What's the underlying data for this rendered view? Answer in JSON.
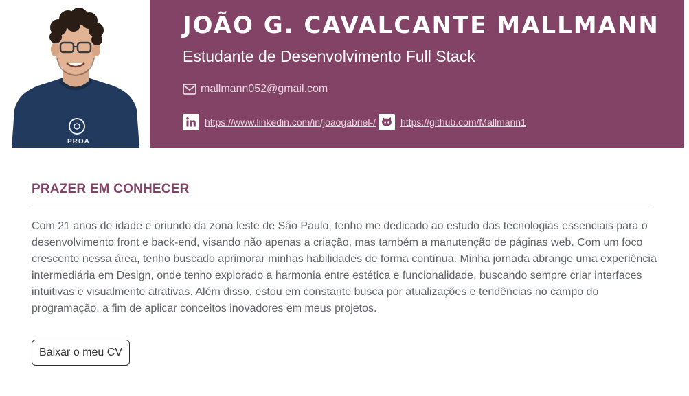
{
  "profile": {
    "name": "JOÃO G. CAVALCANTE MALLMANN",
    "role": "Estudante de Desenvolvimento Full Stack",
    "email": "mallmann052@gmail.com",
    "linkedin_url": "https://www.linkedin.com/in/joaogabriel-/",
    "github_url": "https://github.com/Mallmann1",
    "shirt_text": "PROA",
    "photo_alt": "photo of João"
  },
  "about": {
    "title": "PRAZER EM CONHECER",
    "paragraph": "Com 21 anos de idade e oriundo da zona leste de São Paulo, tenho me dedicado ao estudo das tecnologias essenciais para o desenvolvimento front e back-end, visando não apenas a criação, mas também a manutenção de páginas web. Com um foco crescente nessa área, tenho buscado aprimorar minhas habilidades de forma contínua. Minha jornada abrange uma experiência intermediária em Design, onde tenho explorado a harmonia entre estética e funcionalidade, buscando sempre criar interfaces intuitivas e visualmente atrativas. Além disso, estou em constante busca por atualizações e tendências no campo do programação, a fim de aplicar conceitos inovadores em meus projetos."
  },
  "actions": {
    "download_cv_label": "Baixar o meu CV"
  },
  "icons": {
    "email": "envelope-icon",
    "linkedin": "linkedin-icon",
    "github": "github-icon"
  },
  "colors": {
    "accent": "#824366",
    "link_on_accent": "#e9d7e2",
    "body_text": "#5e6269"
  }
}
